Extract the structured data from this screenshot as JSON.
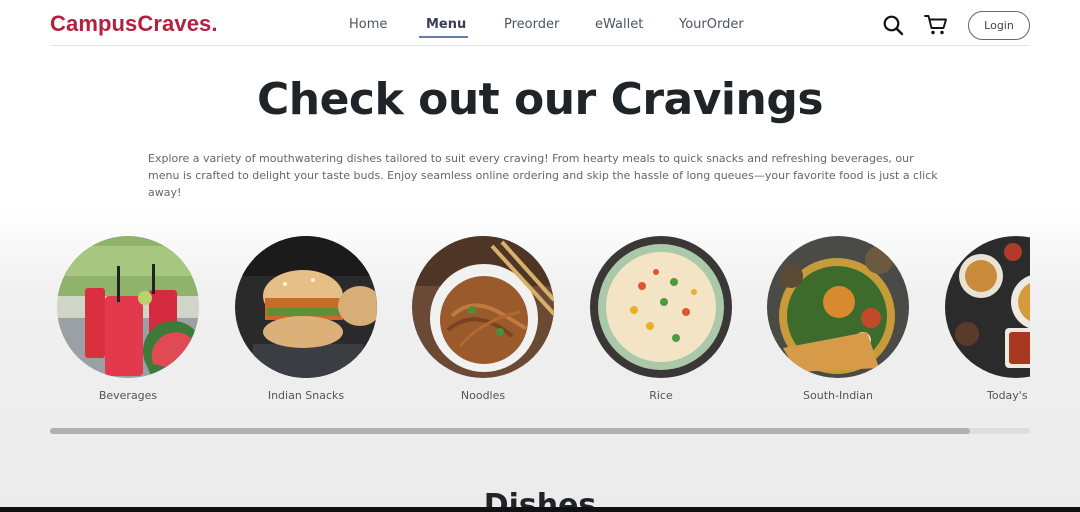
{
  "brand": {
    "name": "CampusCraves.",
    "color": "#b5203f"
  },
  "nav": {
    "items": [
      {
        "label": "Home",
        "active": false
      },
      {
        "label": "Menu",
        "active": true
      },
      {
        "label": "Preorder",
        "active": false
      },
      {
        "label": "eWallet",
        "active": false
      },
      {
        "label": "YourOrder",
        "active": false
      }
    ],
    "search_icon": "search-icon",
    "cart_icon": "cart-icon",
    "login_label": "Login"
  },
  "hero": {
    "title": "Check out our Cravings",
    "description": "Explore a variety of mouthwatering dishes tailored to suit every craving! From hearty meals to quick snacks and refreshing beverages, our menu is crafted to delight your taste buds. Enjoy seamless online ordering and skip the hassle of long queues—your favorite food is just a click away!"
  },
  "categories": [
    {
      "label": "Beverages",
      "image": "watermelon-juice-glasses"
    },
    {
      "label": "Indian Snacks",
      "image": "vada-pav"
    },
    {
      "label": "Noodles",
      "image": "noodles-bowl-with-chopsticks"
    },
    {
      "label": "Rice",
      "image": "fried-rice-bowl"
    },
    {
      "label": "South-Indian",
      "image": "dosa-thali"
    },
    {
      "label": "Today's Sp",
      "image": "assorted-dishes"
    }
  ],
  "scrollbar": {
    "position_fraction": 0.94
  },
  "sections": {
    "dishes_heading": "Dishes"
  }
}
